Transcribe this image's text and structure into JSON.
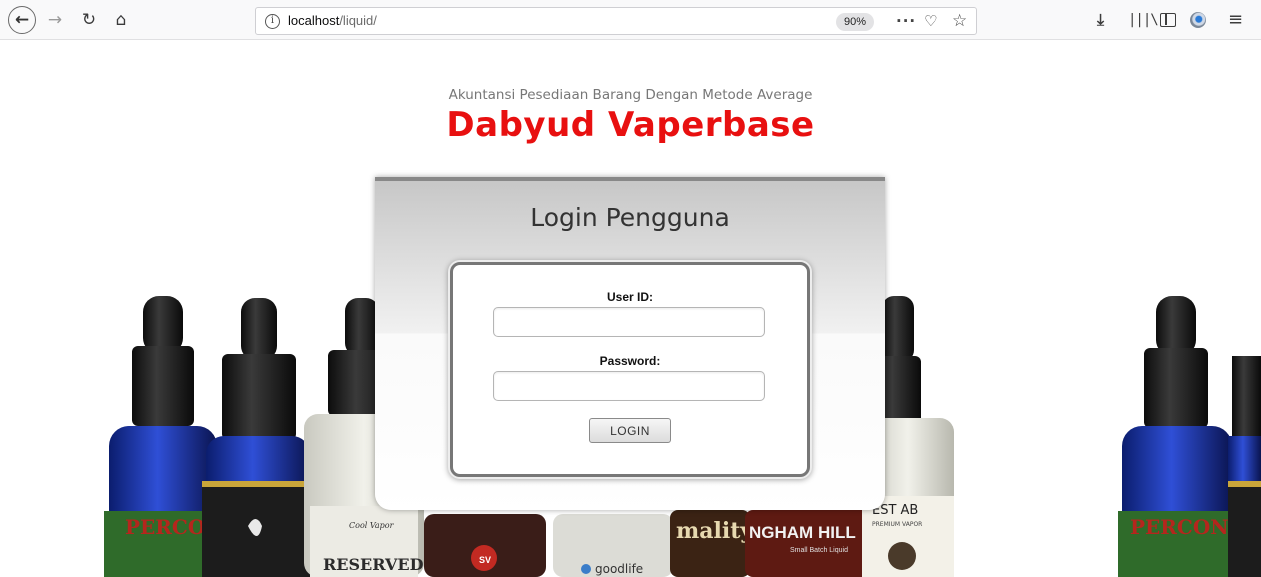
{
  "browser": {
    "url_host": "localhost",
    "url_path": "/liquid/",
    "zoom": "90%",
    "info_glyph": "i",
    "icons": {
      "back": "back-arrow-icon",
      "forward": "forward-arrow-icon",
      "reload": "reload-icon",
      "home": "home-icon",
      "more": "more-actions-icon",
      "pocket": "pocket-icon",
      "bookmark": "star-bookmark-icon",
      "download": "download-icon",
      "library": "library-icon",
      "sidebar": "sidebar-icon",
      "account": "account-icon",
      "menu": "hamburger-menu-icon"
    }
  },
  "header": {
    "subtitle": "Akuntansi Pesediaan Barang Dengan Metode Average",
    "brand": "Dabyud Vaperbase",
    "brand_color": "#e81010"
  },
  "login": {
    "title": "Login Pengguna",
    "userid_label": "User ID:",
    "userid_value": "",
    "password_label": "Password:",
    "password_value": "",
    "button_label": "LOGIN"
  },
  "hero": {
    "image": "e-liquid bottles photo",
    "labels": [
      "PERCON",
      "RESERVED",
      "Cool Vapor",
      "goodlife",
      "NGHAM HILL",
      "Small Batch Liquid",
      "EST AB",
      "PREMIUM VAPOR",
      "SV"
    ]
  }
}
